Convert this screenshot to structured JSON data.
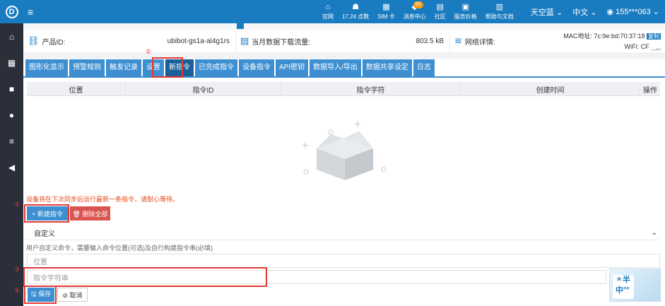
{
  "topbar": {
    "logo": "D",
    "icons": [
      {
        "glyph": "⌂",
        "label": "官网"
      },
      {
        "glyph": "☗",
        "label": "17.24 点数"
      },
      {
        "glyph": "▦",
        "label": "SIM 卡"
      },
      {
        "glyph": "◆",
        "label": "消息中心",
        "badge": "95"
      },
      {
        "glyph": "▤",
        "label": "社区"
      },
      {
        "glyph": "▣",
        "label": "服务价格"
      },
      {
        "glyph": "▥",
        "label": "帮助与文档"
      }
    ],
    "right": {
      "tianqi": "天空蓝",
      "lang": "中文",
      "user": "155***063"
    }
  },
  "sidebar": [
    "⌂",
    "▦",
    "■",
    "●",
    "≡",
    "◀"
  ],
  "info": {
    "product_id_label": "产品ID:",
    "product_id_value": "ubibot-gs1a-al4g1rs",
    "traffic_label": "当月数据下载流量:",
    "traffic_value": "803.5 kB",
    "network_label": "网络详情:",
    "mac_label": "MAC地址: 7c:9e:bd:70:37:18",
    "copy_label": "复制",
    "wifi_label": "WiFi: CF"
  },
  "tabs": [
    "图形化显示",
    "预警规则",
    "触发记录",
    "设置",
    "新指令",
    "已完成指令",
    "设备指令",
    "API密钥",
    "数据导入/导出",
    "数据共享设定",
    "日志"
  ],
  "table": {
    "headers": [
      "位置",
      "指令ID",
      "指令字符",
      "创建时间",
      "操作"
    ]
  },
  "note": "设备将在下次同步后运行最新一条指令，请耐心等待。",
  "buttons": {
    "new_command": "+ 新建指令",
    "delete_all": "🗑 删除全部",
    "save": "🖫 保存",
    "cancel": "⊘ 取消"
  },
  "select_value": "自定义",
  "hint": "用户自定义命令，需要输入命令位置(可选)及自行构建指令串(必填)",
  "inputs": {
    "position_placeholder": "位置",
    "command_placeholder": "指令字符串"
  },
  "annotations": [
    "①",
    "②",
    "③",
    "④"
  ],
  "ime": {
    "line1": "☀半",
    "line2": "中°°"
  },
  "colors": {
    "primary": "#1a7cc0",
    "danger": "#d9534f",
    "annotation": "#e53935"
  }
}
